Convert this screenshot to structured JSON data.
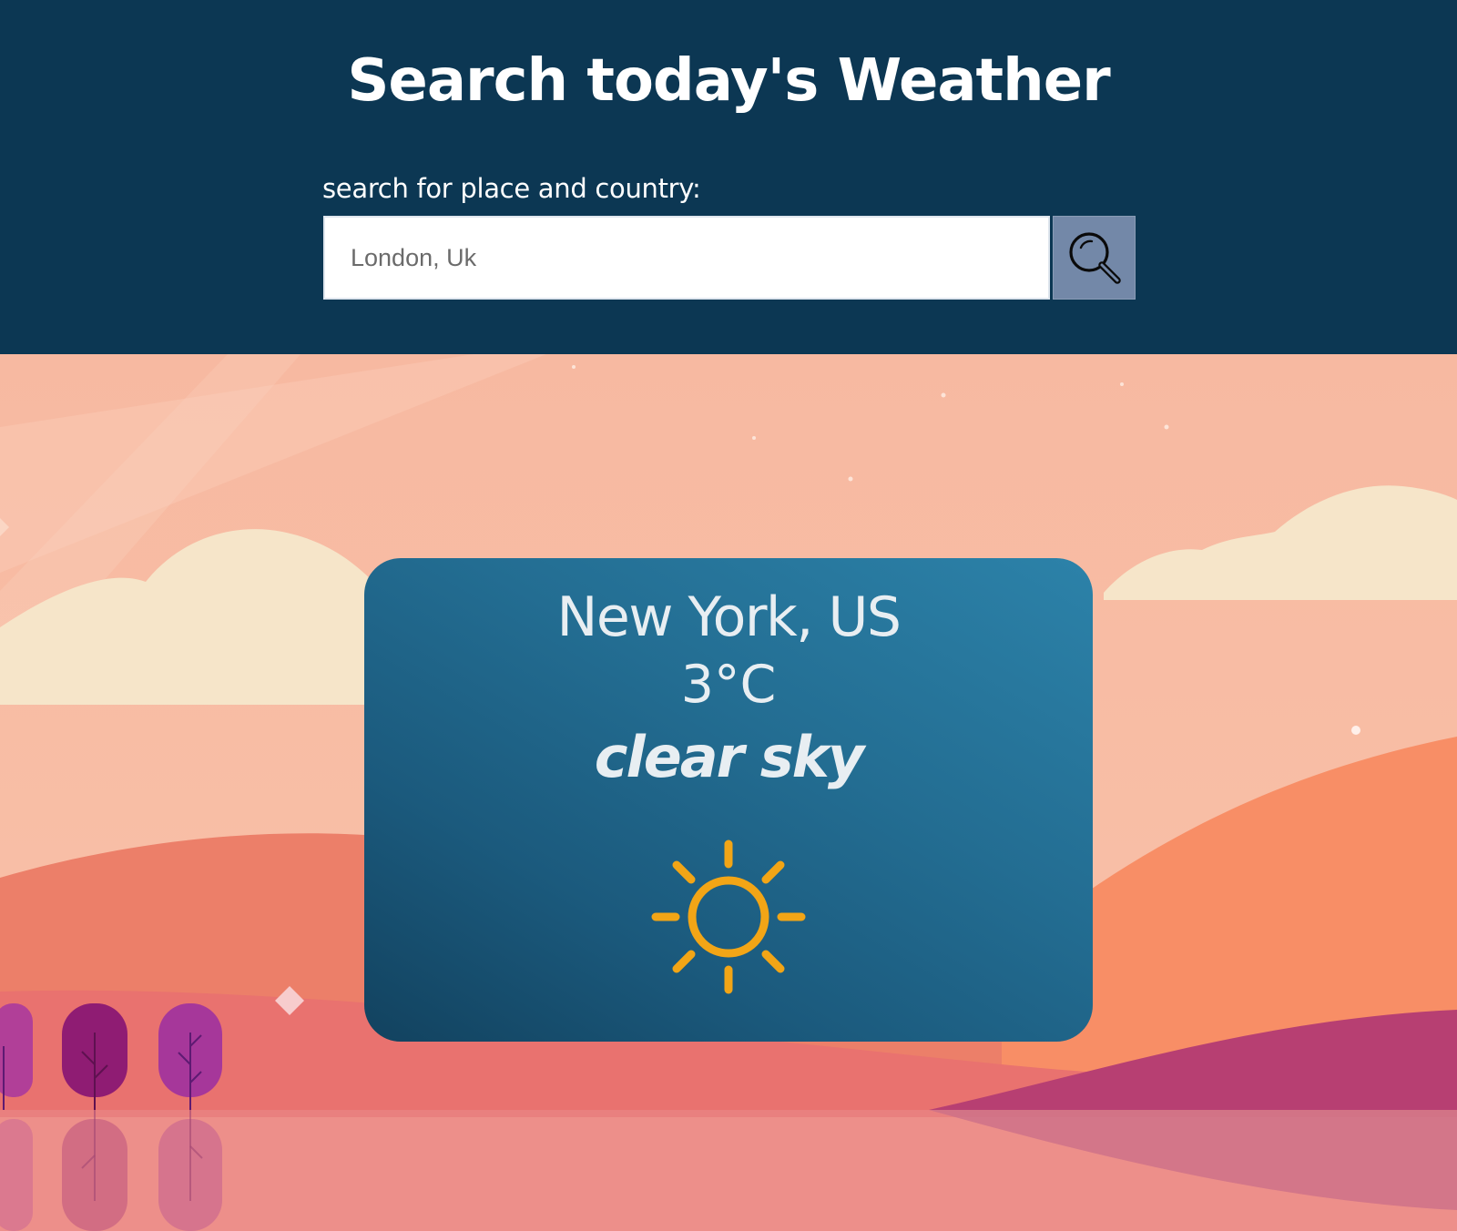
{
  "header": {
    "title": "Search today's Weather",
    "search_label": "search for place and country:",
    "search_placeholder": "London, Uk",
    "search_icon": "magnifier-icon"
  },
  "weather": {
    "location": "New York, US",
    "temperature": "3°C",
    "description": "clear sky",
    "icon": "sun-icon"
  },
  "colors": {
    "header_bg": "#0c3753",
    "search_button_bg": "#7388a8",
    "card_gradient_light": "#2c82a9",
    "card_gradient_dark": "#12425f",
    "sun_color": "#f2a516"
  }
}
